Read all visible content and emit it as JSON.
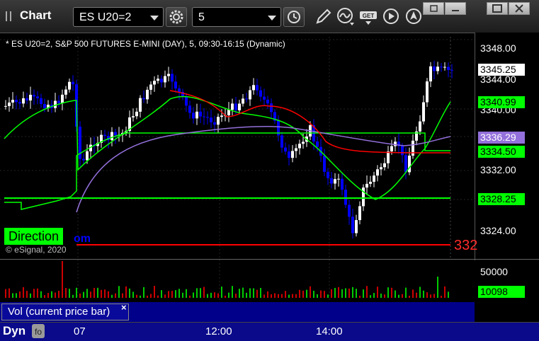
{
  "titlebar": {
    "title": "Chart",
    "symbol": "ES U20=2",
    "interval": "5",
    "icons": [
      "settings-gear-icon",
      "time-clock-icon",
      "pencil-draw-icon",
      "study-wave-icon",
      "get-data-icon",
      "play-icon",
      "cursor-arrow-icon"
    ],
    "window_buttons": [
      "restore-icon",
      "minimize-icon",
      "maximize-icon",
      "close-icon"
    ]
  },
  "chart": {
    "info": "* ES U20=2, S&P 500 FUTURES E-MINI (DAY), 5, 09:30-16:15 (Dynamic)",
    "direction_label": "Direction",
    "overlay_partial_text": "om",
    "copyright": "© eSignal, 2020",
    "red_line_value": "332",
    "price_axis": [
      "3348.00",
      "3344.00",
      "3340.00",
      "3332.00",
      "3324.00"
    ],
    "price_tags": [
      {
        "value": "3345.25",
        "bg": "#ffffff",
        "fg": "#000000"
      },
      {
        "value": "3340.99",
        "bg": "#00ff00",
        "fg": "#000000"
      },
      {
        "value": "3336.29",
        "bg": "#9370db",
        "fg": "#ffffff"
      },
      {
        "value": "3334.50",
        "bg": "#00ff00",
        "fg": "#000000"
      },
      {
        "value": "3328.25",
        "bg": "#00ff00",
        "fg": "#000000"
      }
    ],
    "colors": {
      "up": "#ffffff",
      "down": "#0000ff",
      "ma_green": "#00ff00",
      "ma_red": "#ff0000",
      "ma_purple": "#9370db"
    }
  },
  "volume": {
    "label": "Vol (current price bar)",
    "close_glyph": "×",
    "axis_value": "50000",
    "current_tag": "10098"
  },
  "bottombar": {
    "label": "Dyn",
    "time_labels": [
      "07",
      "12:00",
      "14:00"
    ]
  }
}
